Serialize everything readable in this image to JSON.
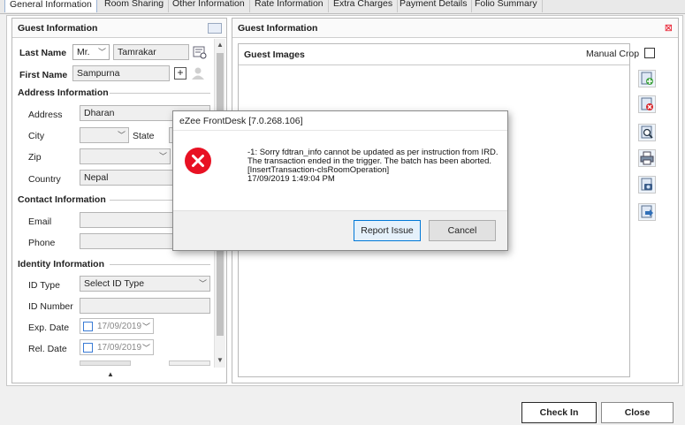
{
  "tabs": [
    "General Information",
    "Room Sharing",
    "Other Information",
    "Rate Information",
    "Extra Charges",
    "Payment Details",
    "Folio Summary"
  ],
  "guest_info": {
    "title": "Guest Information",
    "last_name_label": "Last Name",
    "salutation": "Mr.",
    "last_name": "Tamrakar",
    "first_name_label": "First Name",
    "first_name": "Sampurna",
    "address_section": "Address Information",
    "address_label": "Address",
    "address_value": "Dharan",
    "city_label": "City",
    "state_label": "State",
    "zip_label": "Zip",
    "country_label": "Country",
    "country_value": "Nepal",
    "contact_section": "Contact Information",
    "email_label": "Email",
    "phone_label": "Phone",
    "identity_section": "Identity Information",
    "id_type_label": "ID Type",
    "id_type_value": "Select ID Type",
    "id_number_label": "ID Number",
    "exp_date_label": "Exp. Date",
    "exp_date_value": "17/09/2019",
    "rel_date_label": "Rel. Date",
    "rel_date_value": "17/09/2019"
  },
  "guest_images": {
    "panel_title": "Guest Information",
    "images_label": "Guest Images",
    "manual_crop_label": "Manual Crop"
  },
  "dialog": {
    "title": "eZee FrontDesk [7.0.268.106]",
    "message_lines": [
      "-1: Sorry fdtran_info cannot be updated as per instruction from IRD.",
      "The transaction ended in the trigger. The batch has been aborted.",
      "[InsertTransaction-clsRoomOperation]",
      "17/09/2019 1:49:04 PM"
    ],
    "report_button": "Report Issue",
    "cancel_button": "Cancel"
  },
  "footer": {
    "check_in_button": "Check In",
    "close_button": "Close"
  },
  "colors": {
    "error_red": "#e81123",
    "focus_blue": "#0078d7",
    "tab_border": "#9bb4d6"
  }
}
